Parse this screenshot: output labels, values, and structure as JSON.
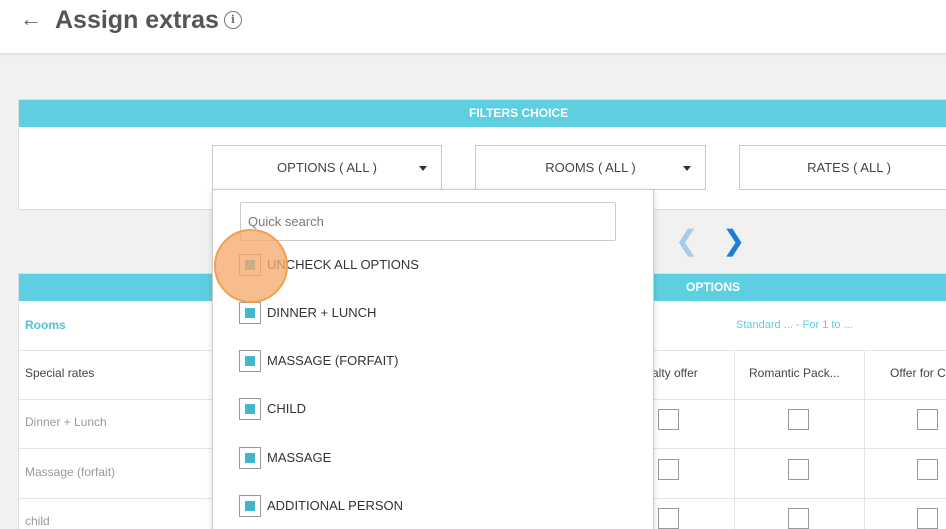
{
  "header": {
    "back_icon": "arrow-left-icon",
    "title": "Assign extras",
    "info_icon": "info-icon"
  },
  "filters": {
    "title": "FILTERS CHOICE",
    "options_label": "OPTIONS ( ALL )",
    "rooms_label": "ROOMS ( ALL )",
    "rates_label": "RATES ( ALL )"
  },
  "pager": {
    "prev_icon": "chevron-left-icon",
    "next_icon": "chevron-right-icon"
  },
  "options_table": {
    "title": "OPTIONS",
    "rooms_label": "Rooms",
    "group_label": "Standard ... - For 1 to ...",
    "columns": [
      "alty offer",
      "Romantic Pack...",
      "Offer for C"
    ],
    "rows": [
      "Special rates",
      "Dinner + Lunch",
      "Massage (forfait)",
      "child"
    ]
  },
  "dropdown": {
    "search_placeholder": "Quick search",
    "items": [
      {
        "label": "UNCHECK ALL OPTIONS",
        "checked": true
      },
      {
        "label": "DINNER + LUNCH",
        "checked": true
      },
      {
        "label": "MASSAGE (FORFAIT)",
        "checked": true
      },
      {
        "label": "CHILD",
        "checked": true
      },
      {
        "label": "MASSAGE",
        "checked": true
      },
      {
        "label": "ADDITIONAL PERSON",
        "checked": true
      }
    ]
  },
  "colors": {
    "accent": "#5dcfe0",
    "checkbox_fill": "#3fb8cc",
    "nav_active": "#1e7fd6",
    "click_marker": "#f5aa6e"
  }
}
